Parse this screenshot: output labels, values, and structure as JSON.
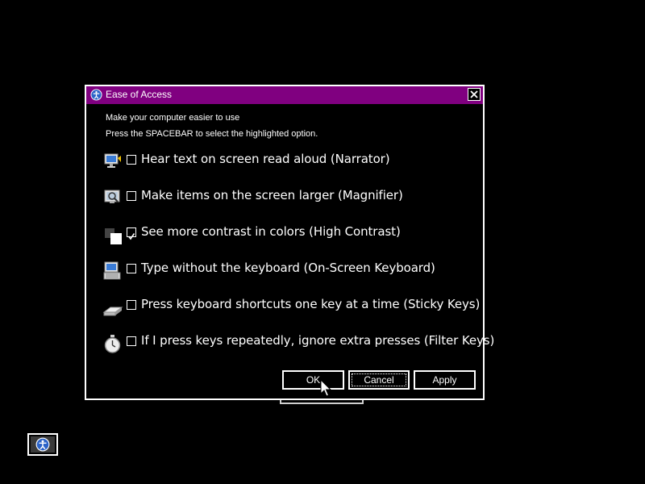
{
  "dialog": {
    "title": "Ease of Access",
    "close_label": "×",
    "intro_line1": "Make your computer easier to use",
    "intro_line2": "Press the SPACEBAR to select the highlighted option."
  },
  "options": [
    {
      "label": "Hear text on screen read aloud (Narrator)",
      "checked": false,
      "icon": "narrator-icon"
    },
    {
      "label": "Make items on the screen larger (Magnifier)",
      "checked": false,
      "icon": "magnifier-icon"
    },
    {
      "label": "See more contrast in colors (High Contrast)",
      "checked": true,
      "icon": "high-contrast-icon"
    },
    {
      "label": "Type without the keyboard (On-Screen Keyboard)",
      "checked": false,
      "icon": "on-screen-keyboard-icon"
    },
    {
      "label": "Press keyboard shortcuts one key at a time (Sticky Keys)",
      "checked": false,
      "icon": "sticky-keys-icon"
    },
    {
      "label": "If I press keys repeatedly, ignore extra presses (Filter Keys)",
      "checked": false,
      "icon": "filter-keys-icon"
    }
  ],
  "buttons": {
    "ok": "OK",
    "cancel": "Cancel",
    "apply": "Apply"
  },
  "colors": {
    "titlebar": "#800080",
    "background": "#000000",
    "foreground": "#ffffff"
  },
  "tray": {
    "icon": "ease-of-access-icon"
  }
}
